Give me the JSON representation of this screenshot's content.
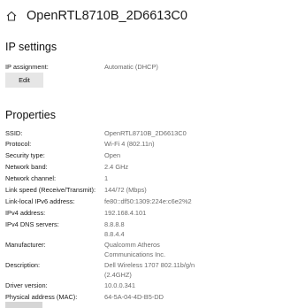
{
  "page": {
    "title": "OpenRTL8710B_2D6613C0"
  },
  "ip_settings": {
    "heading": "IP settings",
    "assignment_label": "IP assignment:",
    "assignment_value": "Automatic (DHCP)",
    "edit_label": "Edit"
  },
  "properties": {
    "heading": "Properties",
    "rows": [
      {
        "label": "SSID:",
        "value": "OpenRTL8710B_2D6613C0"
      },
      {
        "label": "Protocol:",
        "value": "Wi-Fi 4 (802.11n)"
      },
      {
        "label": "Security type:",
        "value": "Open"
      },
      {
        "label": "Network band:",
        "value": "2.4 GHz"
      },
      {
        "label": "Network channel:",
        "value": "1"
      },
      {
        "label": "Link speed (Receive/Transmit):",
        "value": "144/72 (Mbps)"
      },
      {
        "label": "Link-local IPv6 address:",
        "value": "fe80::df50:1309:224e:c6e2%2"
      },
      {
        "label": "IPv4 address:",
        "value": "192.168.4.101"
      },
      {
        "label": "IPv4 DNS servers:",
        "value": "8.8.8.8",
        "value2": "8.8.4.4"
      },
      {
        "label": "Manufacturer:",
        "value": "Qualcomm Atheros",
        "value2": "Communications Inc."
      },
      {
        "label": "Description:",
        "value": "Dell Wireless 1707 802.11b/g/n",
        "value2": "(2.4GHZ)"
      },
      {
        "label": "Driver version:",
        "value": "10.0.0.341"
      },
      {
        "label": "Physical address (MAC):",
        "value": "64-5A-04-4D-B5-DD"
      }
    ]
  }
}
